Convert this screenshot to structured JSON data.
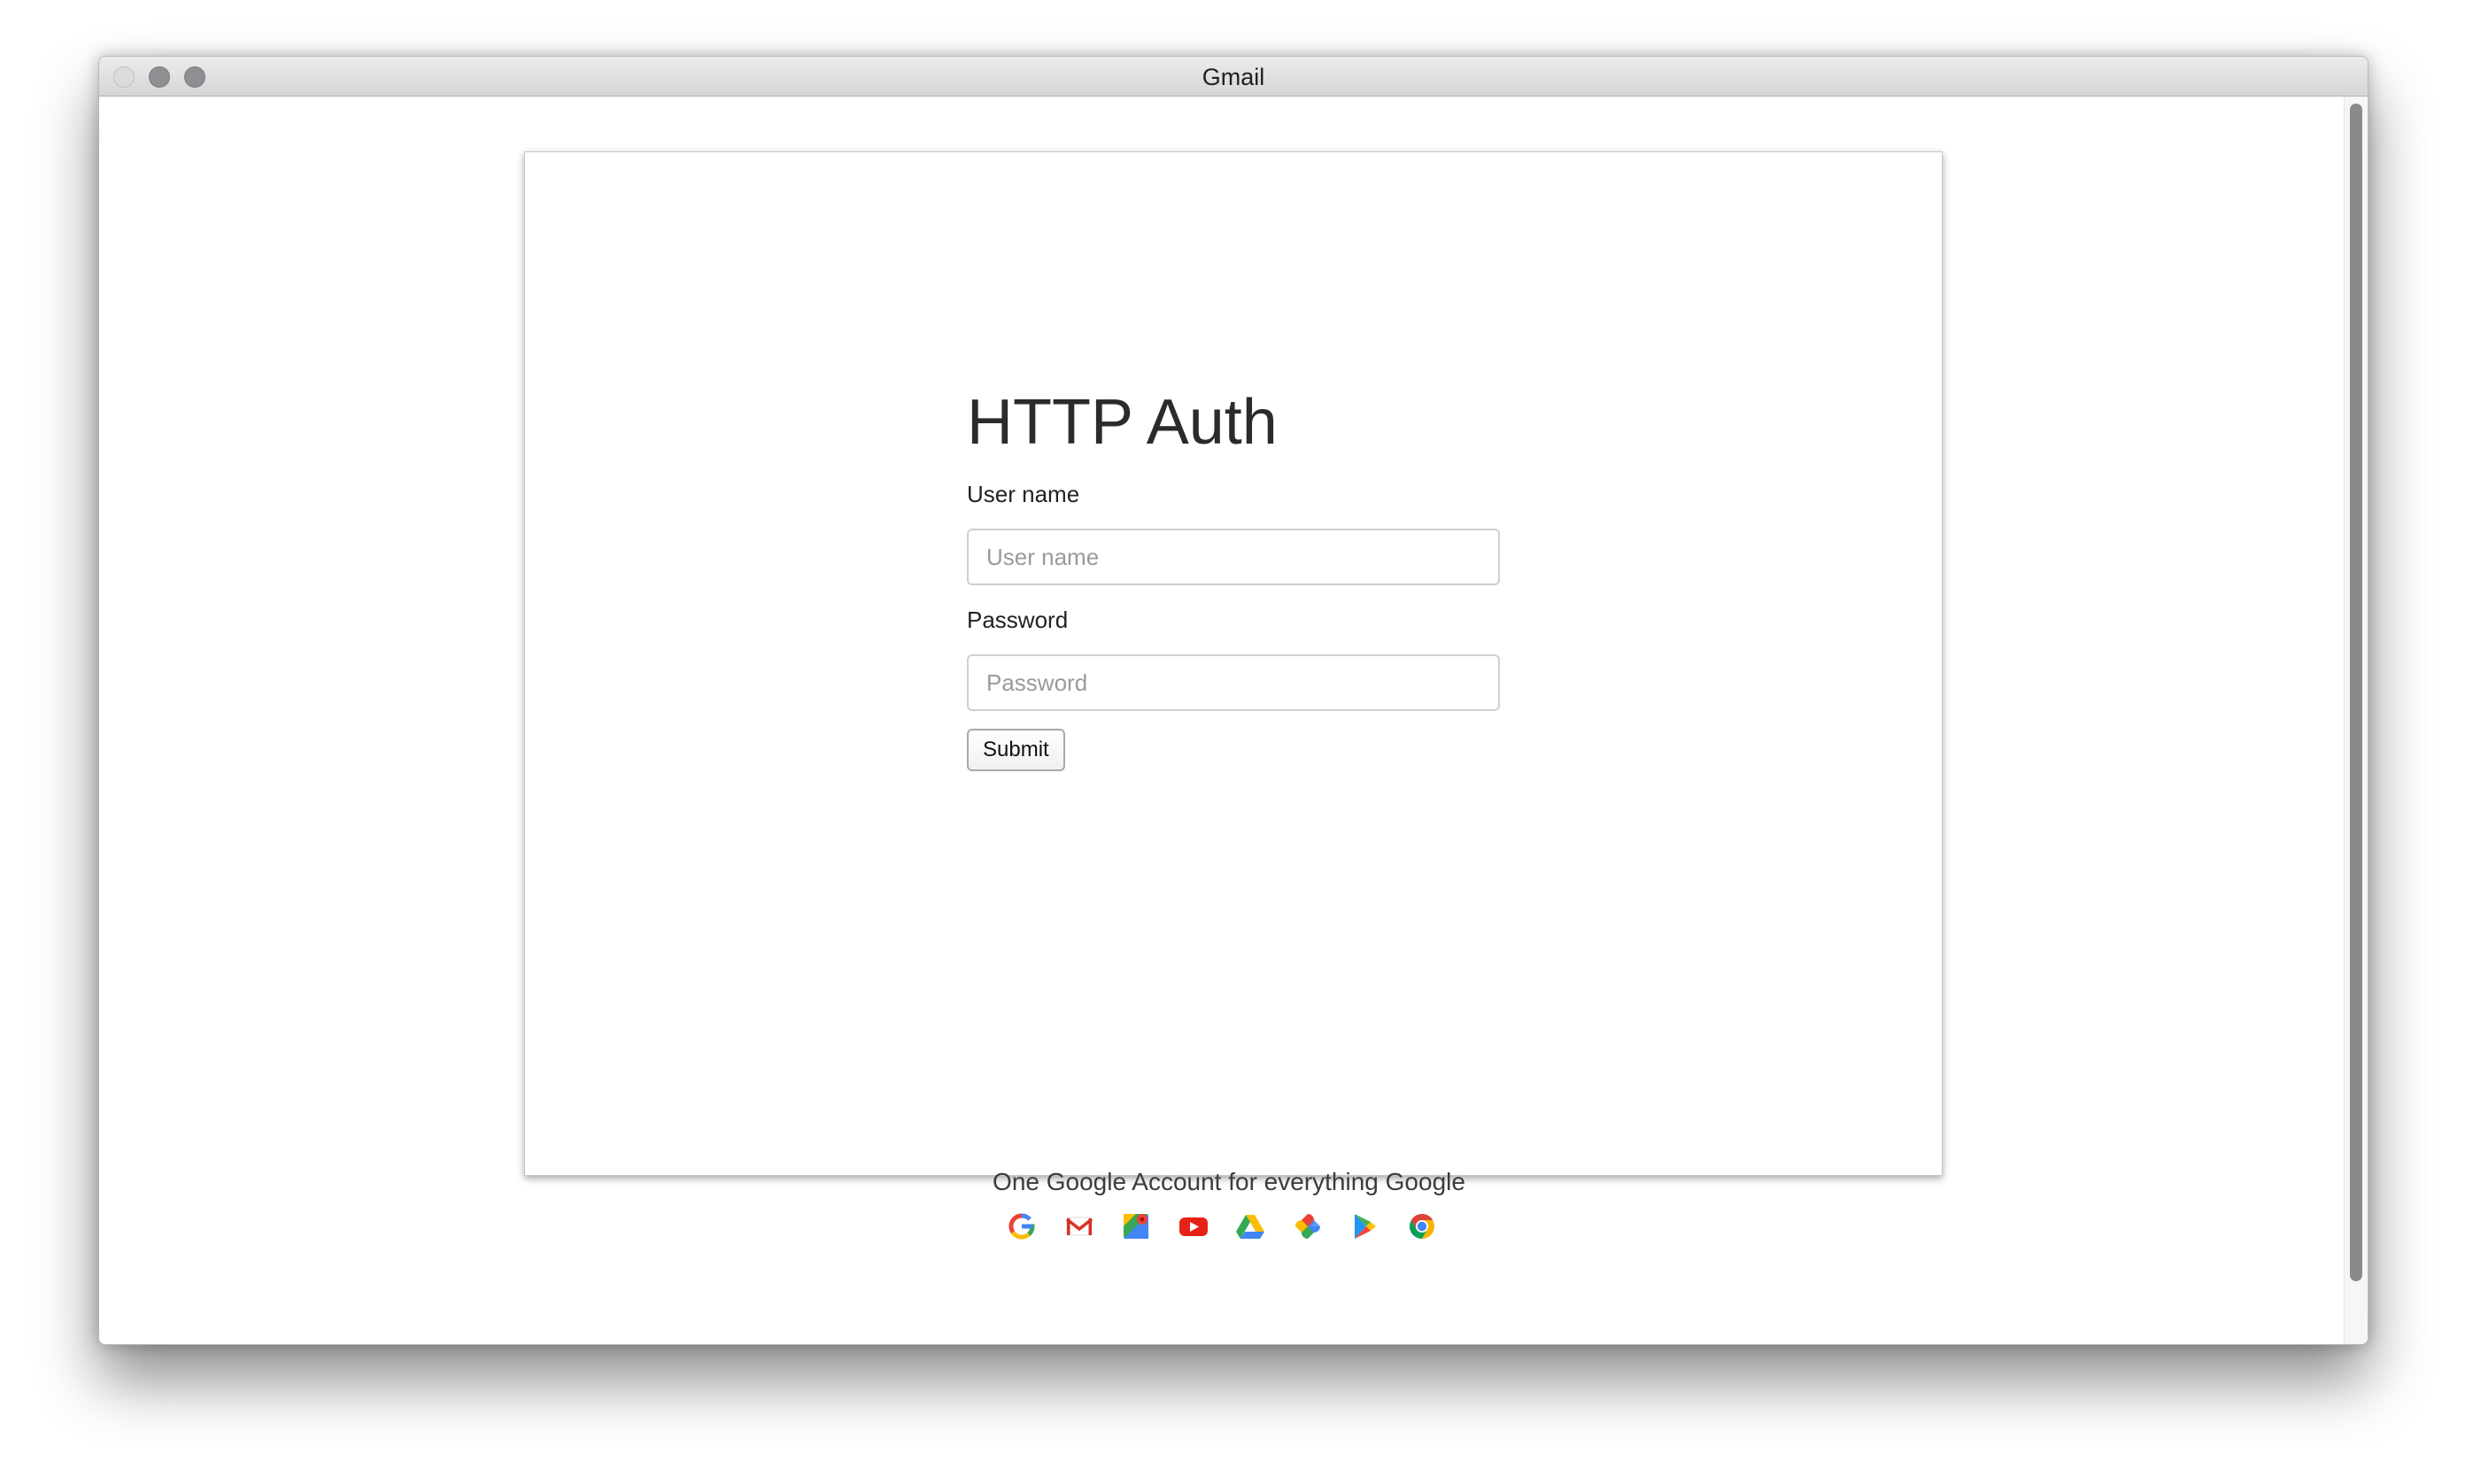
{
  "window": {
    "title": "Gmail"
  },
  "form": {
    "heading": "HTTP Auth",
    "username_label": "User name",
    "username_placeholder": "User name",
    "username_value": "",
    "password_label": "Password",
    "password_placeholder": "Password",
    "password_value": "",
    "submit_label": "Submit"
  },
  "footer": {
    "tagline": "One Google Account for everything Google",
    "icons": [
      "google-icon",
      "gmail-icon",
      "maps-icon",
      "youtube-icon",
      "drive-icon",
      "photos-icon",
      "play-store-icon",
      "chrome-icon"
    ]
  }
}
